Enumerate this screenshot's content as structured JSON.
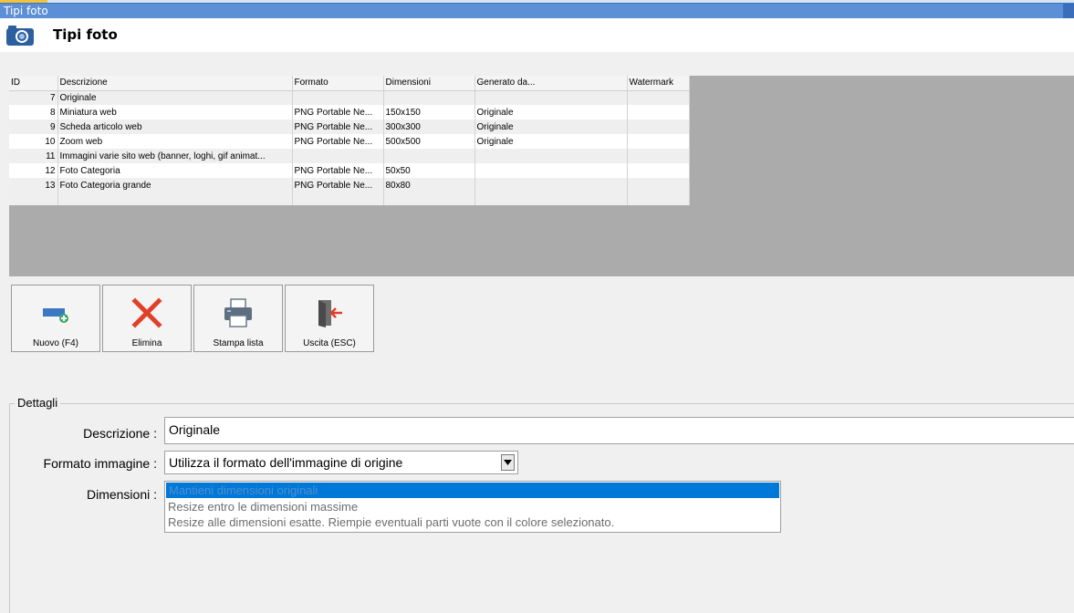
{
  "window": {
    "title": "Tipi foto"
  },
  "header": {
    "title": "Tipi foto",
    "icon": "camera-icon"
  },
  "grid": {
    "columns": [
      "ID",
      "Descrizione",
      "Formato",
      "Dimensioni",
      "Generato da...",
      "Watermark"
    ],
    "rows": [
      {
        "id": "7",
        "descrizione": "Originale",
        "formato": "",
        "dimensioni": "",
        "generato": "",
        "watermark": ""
      },
      {
        "id": "8",
        "descrizione": "Miniatura web",
        "formato": "PNG Portable Ne...",
        "dimensioni": "150x150",
        "generato": "Originale",
        "watermark": ""
      },
      {
        "id": "9",
        "descrizione": "Scheda articolo web",
        "formato": "PNG Portable Ne...",
        "dimensioni": "300x300",
        "generato": "Originale",
        "watermark": ""
      },
      {
        "id": "10",
        "descrizione": "Zoom web",
        "formato": "PNG Portable Ne...",
        "dimensioni": "500x500",
        "generato": "Originale",
        "watermark": ""
      },
      {
        "id": "11",
        "descrizione": "Immagini varie sito web (banner, loghi, gif animat...",
        "formato": "",
        "dimensioni": "",
        "generato": "",
        "watermark": ""
      },
      {
        "id": "12",
        "descrizione": "Foto Categoria",
        "formato": "PNG Portable Ne...",
        "dimensioni": "50x50",
        "generato": "",
        "watermark": ""
      },
      {
        "id": "13",
        "descrizione": "Foto Categoria grande",
        "formato": "PNG Portable Ne...",
        "dimensioni": "80x80",
        "generato": "",
        "watermark": ""
      }
    ]
  },
  "toolbar": {
    "new_label": "Nuovo (F4)",
    "delete_label": "Elimina",
    "print_label": "Stampa lista",
    "exit_label": "Uscita (ESC)"
  },
  "details": {
    "legend": "Dettagli",
    "descrizione_label": "Descrizione :",
    "descrizione_value": "Originale",
    "formato_label": "Formato immagine :",
    "formato_value": "Utilizza il formato dell'immagine di origine",
    "dimensioni_label": "Dimensioni :",
    "dimensioni_options": [
      "Mantieni dimensioni originali",
      "Resize entro le dimensioni massime",
      "Resize alle dimensioni esatte. Riempie eventuali parti vuote con il colore selezionato."
    ]
  },
  "colors": {
    "titlebar": "#5b8fd6",
    "selection": "#0078d7",
    "delete_red": "#e0402a",
    "new_blue": "#3a78c2",
    "add_green": "#3bab6a"
  }
}
